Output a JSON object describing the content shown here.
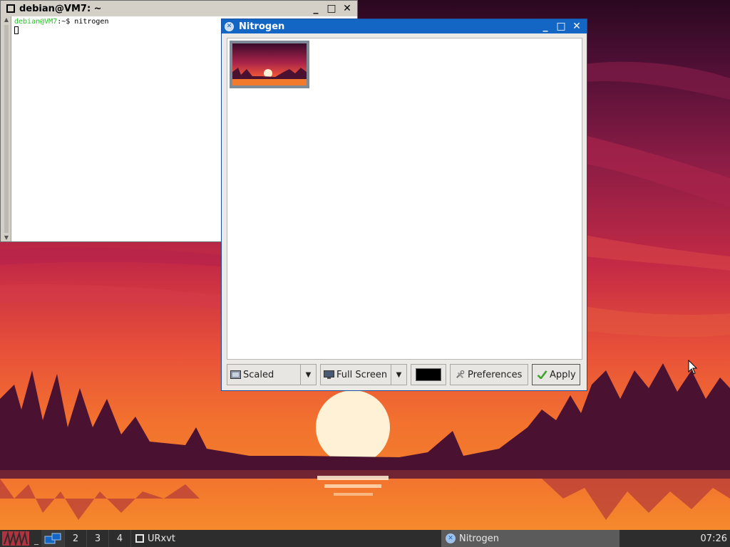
{
  "colors": {
    "nitrogen_titlebar": "#1466c4",
    "taskbar": "#2d2d2d",
    "terminal_prompt": "#22c322",
    "swatch": "#000000"
  },
  "terminal": {
    "title": "debian@VM7: ~",
    "prompt_user": "debian@VM7",
    "prompt_rest": ":~$ nitrogen",
    "icons": [
      "window-icon",
      "minimize-icon",
      "maximize-icon",
      "close-icon"
    ]
  },
  "nitrogen": {
    "title": "Nitrogen",
    "window_controls": {
      "minimize": "_",
      "maximize": "□",
      "close": "✕"
    },
    "zoom_mode": "Scaled",
    "screen_mode": "Full Screen",
    "preferences_label": "Preferences",
    "apply_label": "Apply",
    "icons": [
      "nitrogen-app-icon",
      "scaled-icon",
      "monitor-icon",
      "tools-icon",
      "checkmark-icon",
      "dropdown-arrow-icon"
    ]
  },
  "taskbar": {
    "show_desktop": "_",
    "desktops": [
      "2",
      "3",
      "4"
    ],
    "tasks": [
      {
        "label": "URxvt"
      },
      {
        "label": "Nitrogen"
      }
    ],
    "clock": "07:26"
  }
}
